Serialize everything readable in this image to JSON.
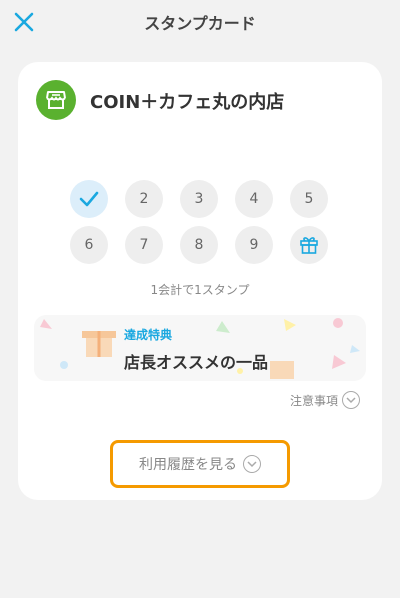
{
  "header": {
    "title": "スタンプカード",
    "close_icon": "close-icon",
    "accent_color": "#1aa8e0"
  },
  "shop": {
    "name": "COIN＋カフェ丸の内店",
    "icon": "shop-icon",
    "icon_color": "#5ab12f"
  },
  "stamps": {
    "items": [
      {
        "label": "",
        "stamped": true
      },
      {
        "label": "2",
        "stamped": false
      },
      {
        "label": "3",
        "stamped": false
      },
      {
        "label": "4",
        "stamped": false
      },
      {
        "label": "5",
        "stamped": false
      },
      {
        "label": "6",
        "stamped": false
      },
      {
        "label": "7",
        "stamped": false
      },
      {
        "label": "8",
        "stamped": false
      },
      {
        "label": "9",
        "stamped": false
      },
      {
        "label": "",
        "stamped": false,
        "icon": "gift-icon"
      }
    ],
    "note": "1会計で1スタンプ"
  },
  "reward": {
    "label": "達成特典",
    "item": "店長オススメの一品"
  },
  "caution": {
    "label": "注意事項"
  },
  "history": {
    "label": "利用履歴を見る",
    "highlight_color": "#f59a00"
  }
}
